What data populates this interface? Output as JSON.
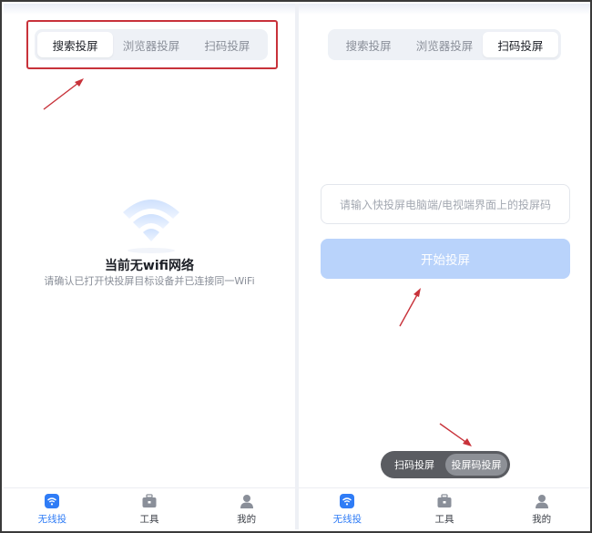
{
  "left_panel": {
    "tabs": [
      {
        "label": "搜索投屏",
        "active": true
      },
      {
        "label": "浏览器投屏",
        "active": false
      },
      {
        "label": "扫码投屏",
        "active": false
      }
    ],
    "no_wifi": {
      "title": "当前无wifi网络",
      "subtitle": "请确认已打开快投屏目标设备并已连接同一WiFi"
    },
    "tabbar": [
      {
        "label": "无线投",
        "icon": "wifi-cast-icon",
        "active": true
      },
      {
        "label": "工具",
        "icon": "toolbox-icon",
        "active": false
      },
      {
        "label": "我的",
        "icon": "profile-icon",
        "active": false
      }
    ]
  },
  "right_panel": {
    "tabs": [
      {
        "label": "搜索投屏",
        "active": false
      },
      {
        "label": "浏览器投屏",
        "active": false
      },
      {
        "label": "扫码投屏",
        "active": true
      }
    ],
    "code_input": {
      "placeholder": "请输入快投屏电脑端/电视端界面上的投屏码",
      "value": ""
    },
    "start_button": "开始投屏",
    "mode_switch": [
      {
        "label": "扫码投屏",
        "active": false
      },
      {
        "label": "投屏码投屏",
        "active": true
      }
    ],
    "tabbar": [
      {
        "label": "无线投",
        "icon": "wifi-cast-icon",
        "active": true
      },
      {
        "label": "工具",
        "icon": "toolbox-icon",
        "active": false
      },
      {
        "label": "我的",
        "icon": "profile-icon",
        "active": false
      }
    ]
  },
  "colors": {
    "accent": "#2f7cf6",
    "button_disabled": "#b9d3fb",
    "annotation_red": "#c8323a",
    "pill_dark": "#5a5c61"
  }
}
